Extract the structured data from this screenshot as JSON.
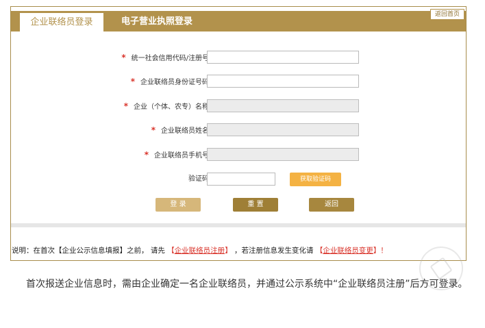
{
  "tabs": {
    "active_label": "企业联络员登录",
    "second_label": "电子营业执照登录",
    "home_label": "返回首页"
  },
  "form": {
    "fields": [
      {
        "label": "统一社会信用代码/注册号",
        "required": true,
        "value": ""
      },
      {
        "label": "企业联络员身份证号码",
        "required": true,
        "value": ""
      },
      {
        "label": "企业（个体、农专）名称",
        "required": true,
        "value": ""
      },
      {
        "label": "企业联络员姓名",
        "required": true,
        "value": ""
      },
      {
        "label": "企业联络员手机号",
        "required": true,
        "value": ""
      }
    ],
    "captcha_label": "验证码",
    "captcha_value": "",
    "get_code_label": "获取验证码"
  },
  "actions": {
    "login": "登  录",
    "reset": "重  置",
    "back": "返回"
  },
  "notice": {
    "prefix": "说明：在首次【企业公示信息填报】之前，  请先",
    "register_link": "企业联络员注册",
    "middle": "，若注册信息发生变化请",
    "change_link": "企业联络员变更",
    "suffix": "！"
  },
  "paragraph": "首次报送企业信息时，需由企业确定一名企业联络员，并通过公示系统中“企业联络员注册”后方可登录。",
  "colors": {
    "accent": "#b2924c",
    "required_star": "#d9342b",
    "get_code_button": "#f4b243"
  }
}
